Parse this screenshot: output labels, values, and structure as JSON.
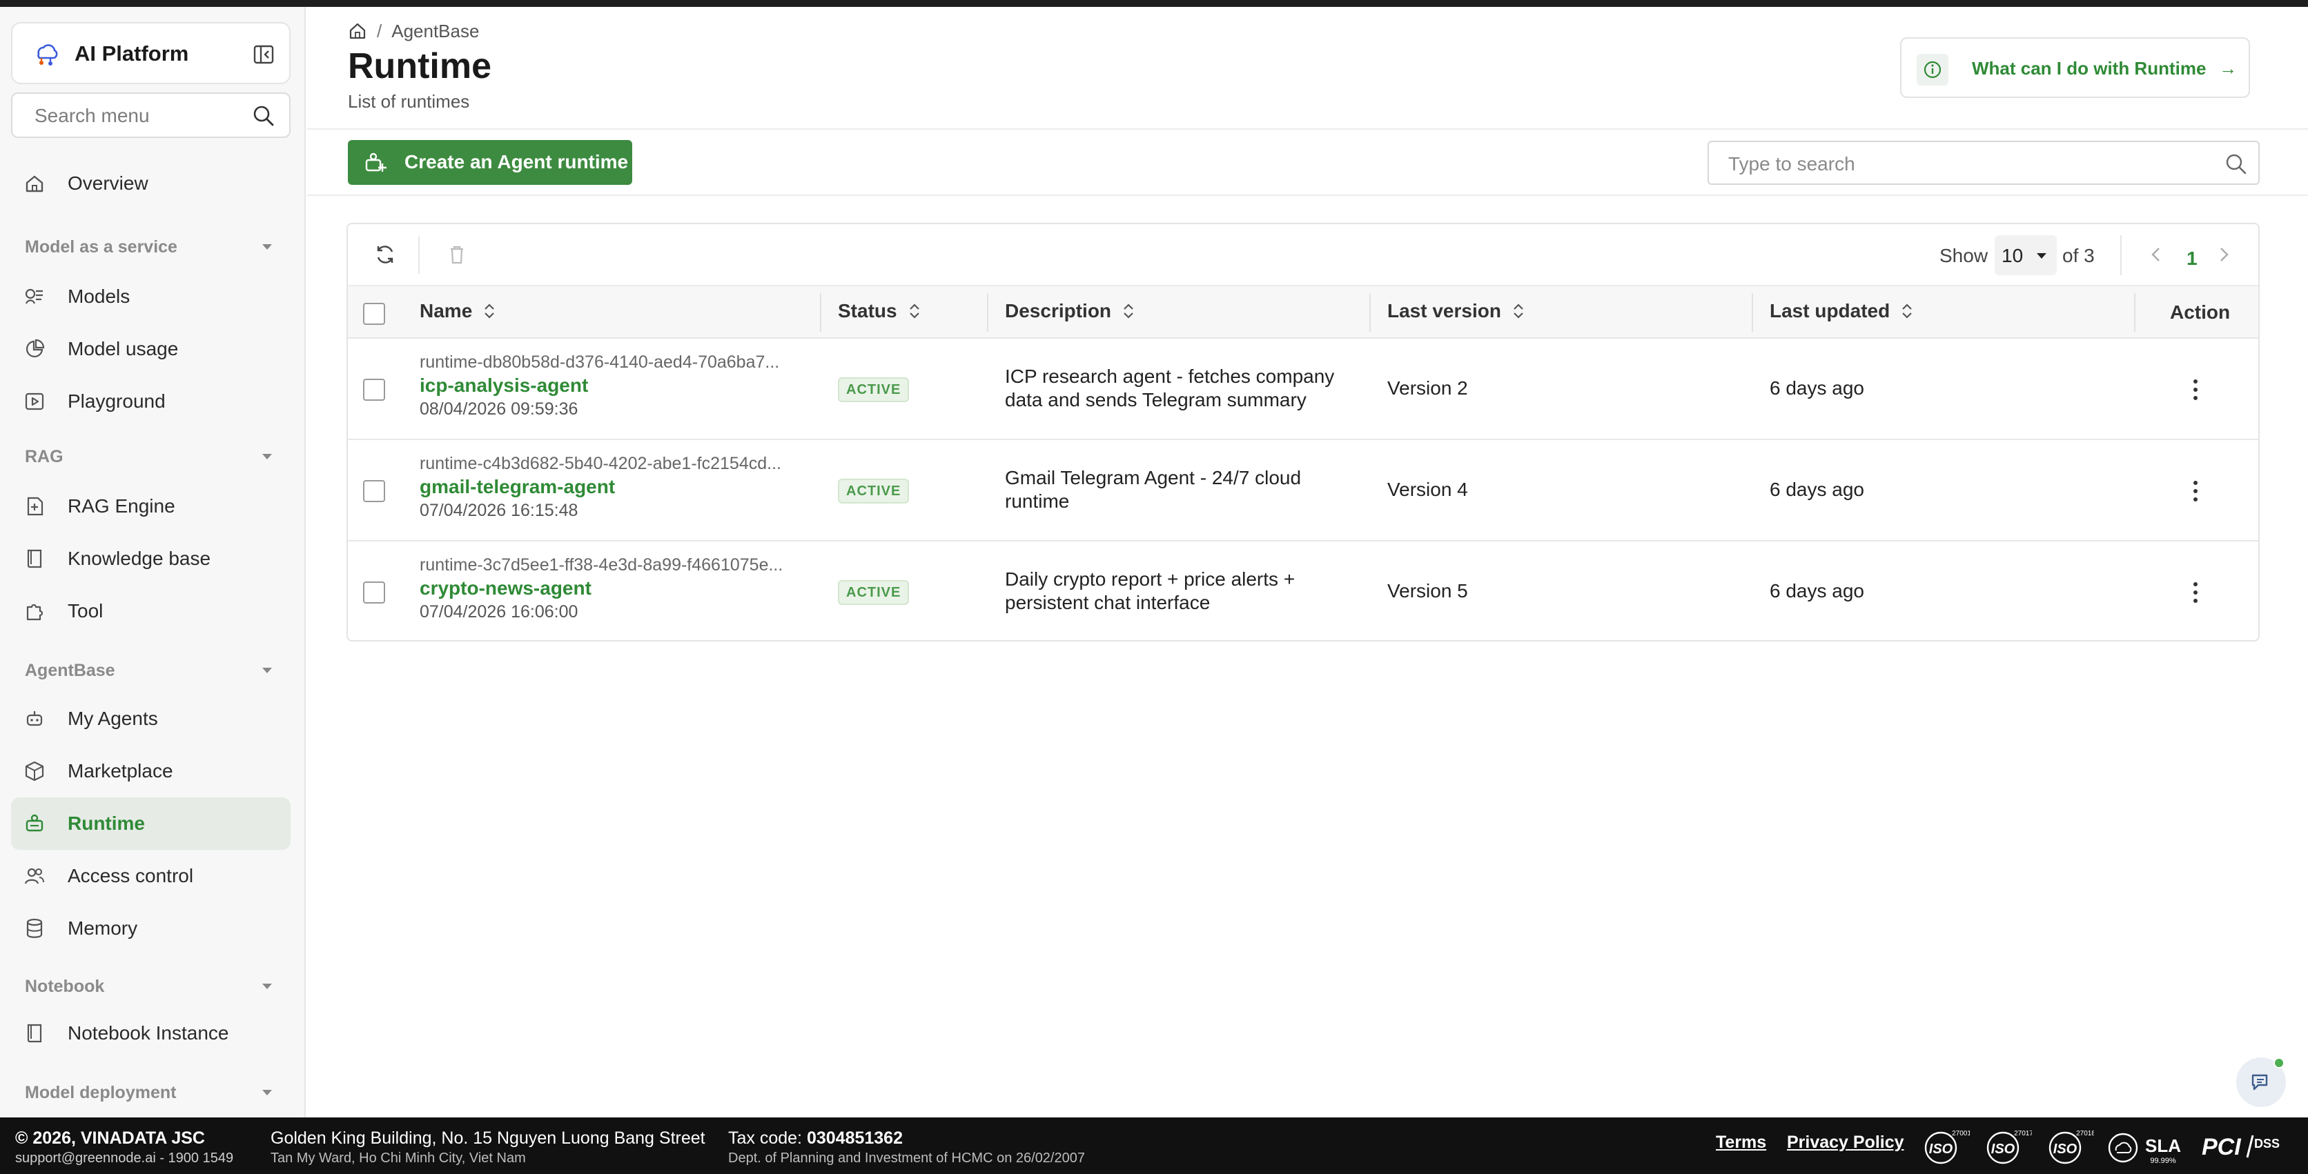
{
  "app": {
    "brand_name": "AI Platform",
    "accent_color": "#3d8b40"
  },
  "sidebar": {
    "search_placeholder": "Search menu",
    "items": {
      "overview": "Overview",
      "models": "Models",
      "model_usage": "Model usage",
      "playground": "Playground",
      "rag_engine": "RAG Engine",
      "knowledge_base": "Knowledge base",
      "tool": "Tool",
      "my_agents": "My Agents",
      "marketplace": "Marketplace",
      "runtime": "Runtime",
      "access_control": "Access control",
      "memory": "Memory",
      "notebook_instance": "Notebook Instance"
    },
    "sections": {
      "maas": "Model as a service",
      "rag": "RAG",
      "agentbase": "AgentBase",
      "notebook": "Notebook",
      "model_deployment": "Model deployment"
    },
    "active_item": "Runtime"
  },
  "header": {
    "breadcrumb_sep": "/",
    "breadcrumb_current": "AgentBase",
    "title": "Runtime",
    "subtitle": "List of runtimes",
    "help_text": "What can I do with Runtime",
    "help_arrow": "→"
  },
  "actions": {
    "create_label": "Create an Agent runtime",
    "search_placeholder": "Type to search"
  },
  "pagination": {
    "show_label": "Show",
    "page_size": "10",
    "of_label": "of 3",
    "current_page": "1"
  },
  "table": {
    "columns": {
      "name": "Name",
      "status": "Status",
      "description": "Description",
      "last_version": "Last version",
      "last_updated": "Last updated",
      "action": "Action"
    },
    "rows": [
      {
        "id": "runtime-db80b58d-d376-4140-aed4-70a6ba7...",
        "name": "icp-analysis-agent",
        "date": "08/04/2026 09:59:36",
        "status": "ACTIVE",
        "description": "ICP research agent - fetches company data and sends Telegram summary",
        "version": "Version 2",
        "updated": "6 days ago"
      },
      {
        "id": "runtime-c4b3d682-5b40-4202-abe1-fc2154cd...",
        "name": "gmail-telegram-agent",
        "date": "07/04/2026 16:15:48",
        "status": "ACTIVE",
        "description": "Gmail Telegram Agent - 24/7 cloud runtime",
        "version": "Version 4",
        "updated": "6 days ago"
      },
      {
        "id": "runtime-3c7d5ee1-ff38-4e3d-8a99-f4661075e...",
        "name": "crypto-news-agent",
        "date": "07/04/2026 16:06:00",
        "status": "ACTIVE",
        "description": "Daily crypto report + price alerts + persistent chat interface",
        "version": "Version 5",
        "updated": "6 days ago"
      }
    ]
  },
  "footer": {
    "copyright": "© 2026, VINADATA JSC",
    "support": "support@greennode.ai - 1900 1549",
    "address": "Golden King Building, No. 15 Nguyen Luong Bang Street",
    "address2": "Tan My Ward, Ho Chi Minh City, Viet Nam",
    "tax_label": "Tax code: ",
    "tax_code": "0304851362",
    "tax_note": "Dept. of Planning and Investment of HCMC on 26/02/2007",
    "terms": "Terms",
    "privacy": "Privacy Policy",
    "cert_iso": "ISO",
    "cert_iso_nums": [
      "27001",
      "27017",
      "27018"
    ],
    "cert_sla": "SLA",
    "cert_sla_value": "99.99%",
    "cert_pci": "PCI",
    "cert_dss": "DSS"
  }
}
